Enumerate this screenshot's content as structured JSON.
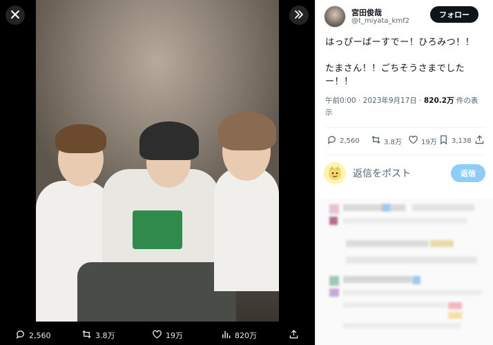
{
  "viewer": {
    "close_icon": "close-icon",
    "expand_icon": "double-chevron-right-icon",
    "actions": {
      "replies": "2,560",
      "reposts": "3.8万",
      "likes": "19万",
      "views": "820万"
    }
  },
  "tweet": {
    "author_name": "宮田俊哉",
    "author_handle": "@t_miyata_kmf2",
    "follow_label": "フォロー",
    "text_line1": "はっぴーばーすでー！ひろみつ！！",
    "text_line2": "たまさん！！ごちそうさまでした",
    "text_line3": "ー！！",
    "meta_time_date": "午前0:00 · 2023年9月17日 · ",
    "meta_views": "820.2万",
    "meta_views_suffix": " 件の表",
    "meta_line2": "示",
    "stats": {
      "replies": "2,560",
      "reposts": "3.8万",
      "likes": "19万",
      "bookmarks": "3,138"
    },
    "reply_placeholder": "返信をポスト",
    "reply_button": "返信"
  },
  "colors": {
    "follow_bg": "#0f1419",
    "reply_button_bg": "#8ecdf7",
    "viewer_bg": "#000000",
    "panel_bg": "#ffffff"
  }
}
